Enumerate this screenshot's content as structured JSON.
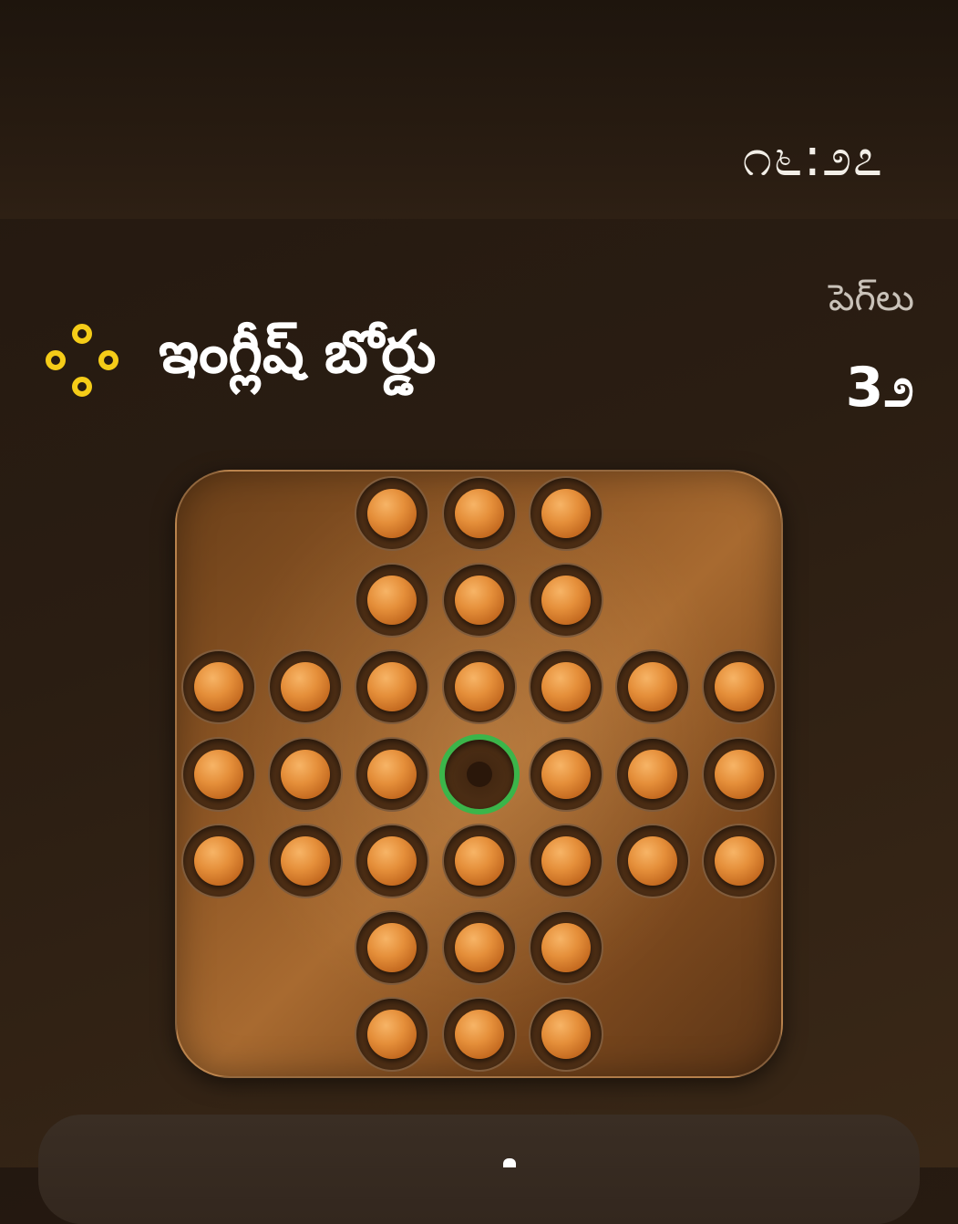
{
  "status_bar": {
    "time": "೧೬:೨೭"
  },
  "header": {
    "title": "ఇంగ్లీష్ బోర్డు",
    "title_icon": "four-rings-icon",
    "peg_label": "పెగ్‌లు",
    "peg_count": "3೨",
    "accent_color": "#f5cc18"
  },
  "board": {
    "layout": "english-cross",
    "rows": 7,
    "cols": 7,
    "pegs_remaining": 32,
    "empty_holes": [
      [
        3,
        3
      ]
    ],
    "selected_hole": [
      3,
      3
    ],
    "peg_color": "#e58f3a",
    "highlight_color": "#3bb54a"
  }
}
